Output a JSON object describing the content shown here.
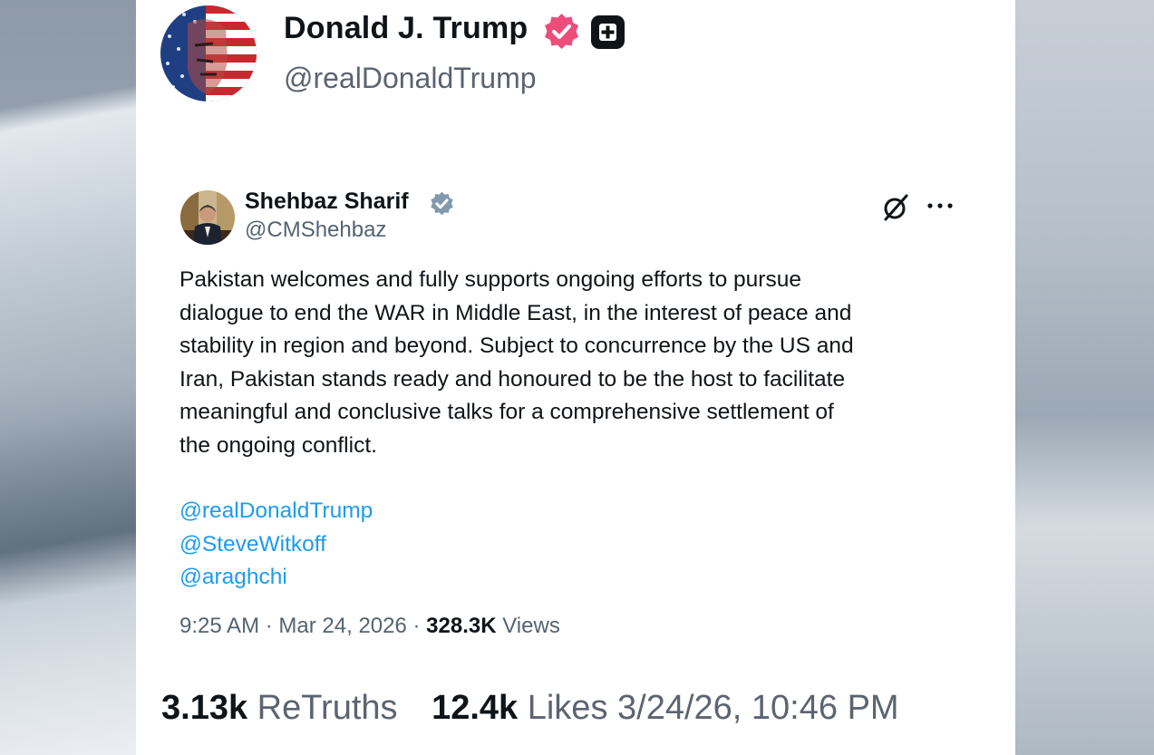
{
  "post": {
    "author_name": "Donald J. Trump",
    "author_handle": "@realDonaldTrump",
    "icons": {
      "verified": "verified-badge-icon",
      "plus": "plus-badge-icon"
    }
  },
  "quoted": {
    "author_name": "Shehbaz Sharif",
    "author_handle": "@CMShehbaz",
    "body_lines": [
      "Pakistan welcomes and fully supports ongoing efforts to pursue",
      "dialogue to end the WAR in Middle East, in the interest of peace and",
      "stability in region and beyond. Subject to concurrence by the US and",
      "Iran, Pakistan stands ready and honoured to be the host to facilitate",
      "meaningful and conclusive talks for a comprehensive settlement of",
      "the ongoing conflict."
    ],
    "mentions": [
      "@realDonaldTrump",
      "@SteveWitkoff",
      "@araghchi"
    ],
    "time": "9:25 AM",
    "date": "Mar 24, 2026",
    "views_count": "328.3K",
    "views_label": "Views",
    "icons": {
      "verified": "verified-badge-icon",
      "grok": "grok-icon",
      "more": "more-icon"
    }
  },
  "stats": {
    "retruths_count": "3.13k",
    "retruths_label": "ReTruths",
    "likes_count": "12.4k",
    "likes_label": "Likes",
    "timestamp": "3/24/26, 10:46 PM"
  },
  "colors": {
    "verified_pink": "#ec4d7a",
    "verified_blue": "#829aab",
    "link": "#1d9bf0",
    "text": "#0f1419",
    "muted": "#536471"
  }
}
